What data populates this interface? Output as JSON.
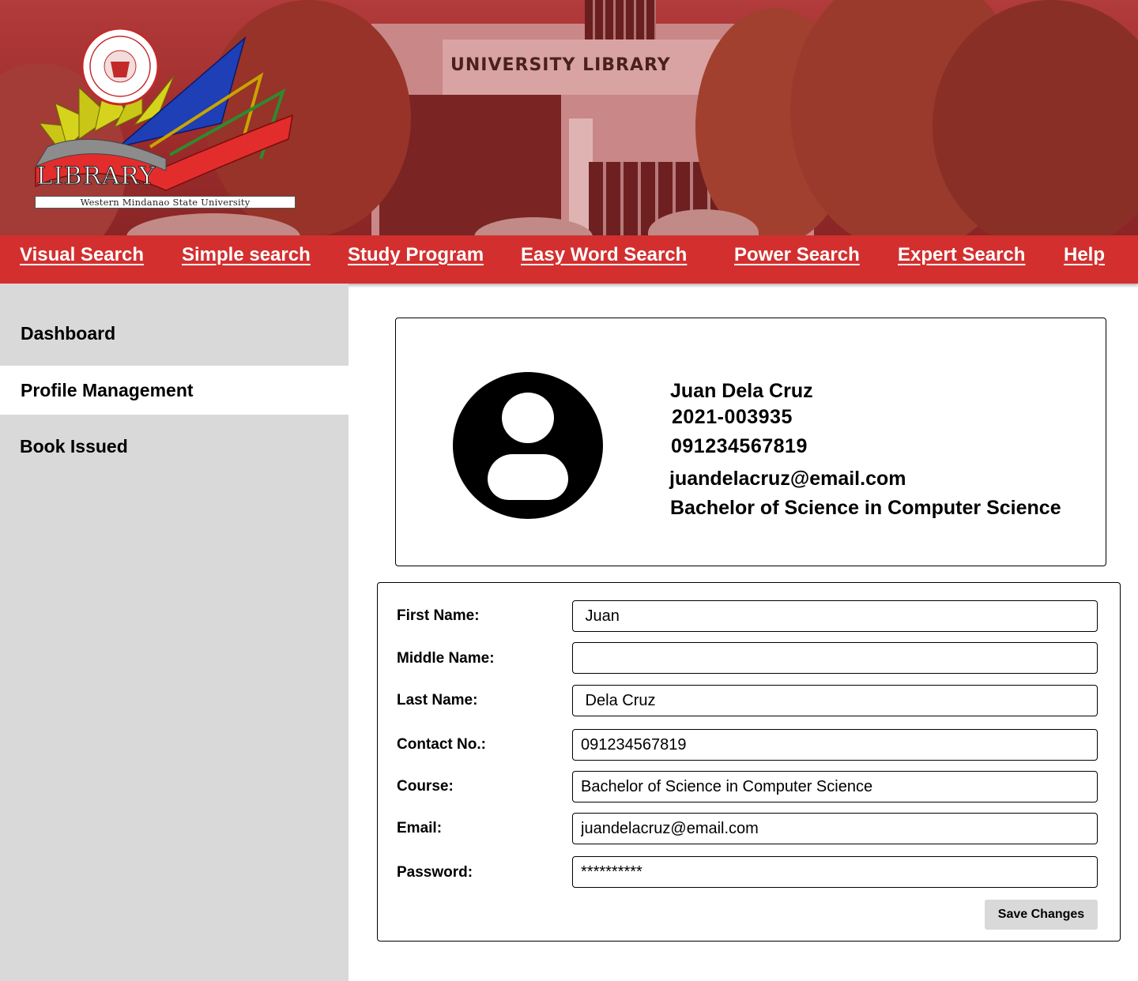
{
  "banner": {
    "building_sign": "UNIVERSITY LIBRARY",
    "logo_title": "LIBRARY",
    "logo_subtitle": "Western Mindanao State University"
  },
  "nav": {
    "items": [
      "Visual Search",
      "Simple search",
      "Study Program",
      "Easy Word Search",
      "Power Search",
      "Expert Search",
      "Help"
    ]
  },
  "sidebar": {
    "items": [
      {
        "label": "Dashboard",
        "active": false
      },
      {
        "label": "Profile Management",
        "active": true
      },
      {
        "label": "Book Issued",
        "active": false
      }
    ]
  },
  "profile": {
    "name": "Juan Dela Cruz",
    "id": "2021-003935",
    "contact": "091234567819",
    "email": "juandelacruz@email.com",
    "course": "Bachelor of Science in Computer Science",
    "avatar_icon": "user-avatar-icon"
  },
  "form": {
    "first_name": {
      "label": "First Name:",
      "value": " Juan"
    },
    "middle_name": {
      "label": "Middle Name:",
      "value": ""
    },
    "last_name": {
      "label": "Last Name:",
      "value": " Dela Cruz"
    },
    "contact": {
      "label": "Contact No.:",
      "value": "091234567819"
    },
    "course": {
      "label": "Course:",
      "value": "Bachelor of Science in Computer Science"
    },
    "email": {
      "label": "Email:",
      "value": "juandelacruz@email.com"
    },
    "password": {
      "label": "Password:",
      "value": "**********"
    },
    "save_label": "Save Changes"
  },
  "colors": {
    "nav_red": "#d32f2f",
    "sidebar_gray": "#d9d9d9",
    "button_gray": "#d9d9d9"
  }
}
